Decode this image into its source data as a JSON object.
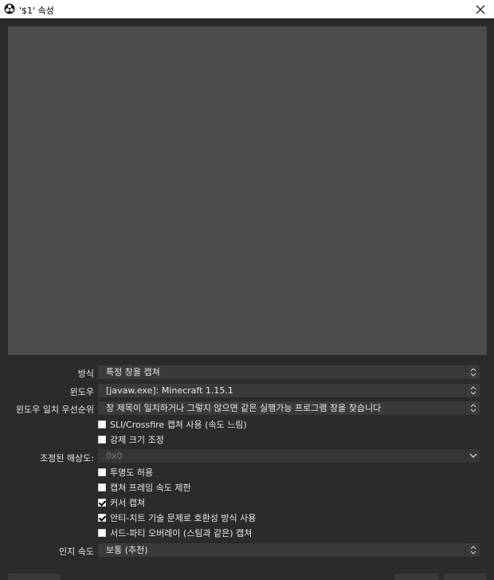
{
  "window": {
    "title": "'$1' 속성"
  },
  "icons": {
    "app": "obs-logo-icon",
    "close": "close-icon",
    "spin": "updown-arrow-icon",
    "dropdown": "chevron-down-icon"
  },
  "form": {
    "mode": {
      "label": "방식",
      "value": "특정 창을 캡쳐"
    },
    "window": {
      "label": "윈도우",
      "value": "[javaw.exe]: Minecraft 1.15.1"
    },
    "priority": {
      "label": "윈도우 일치 우선순위",
      "value": "창 제목이 일치하거나 그렇지 않으면 같은 실행가능 프로그램 창을 찾습니다"
    },
    "sli": {
      "label": "SLI/Crossfire 캡쳐 사용 (속도 느림)",
      "checked": false
    },
    "force_scale": {
      "label": "강제 크기 조정",
      "checked": false
    },
    "scaled_res": {
      "label": "조정된 해상도:",
      "value": "0x0"
    },
    "transparency": {
      "label": "투명도 허용",
      "checked": false
    },
    "limit_framerate": {
      "label": "캡쳐 프레임 속도 제한",
      "checked": false
    },
    "capture_cursor": {
      "label": "커서 캡쳐",
      "checked": true
    },
    "anticheat": {
      "label": "안티-치트 기술 문제로 호환성 방식 사용",
      "checked": true
    },
    "overlays": {
      "label": "서드-파티 오버레이 (스팀과 같은) 캡쳐",
      "checked": false
    },
    "hook_rate": {
      "label": "인지 속도",
      "value": "보통 (추천)"
    }
  }
}
